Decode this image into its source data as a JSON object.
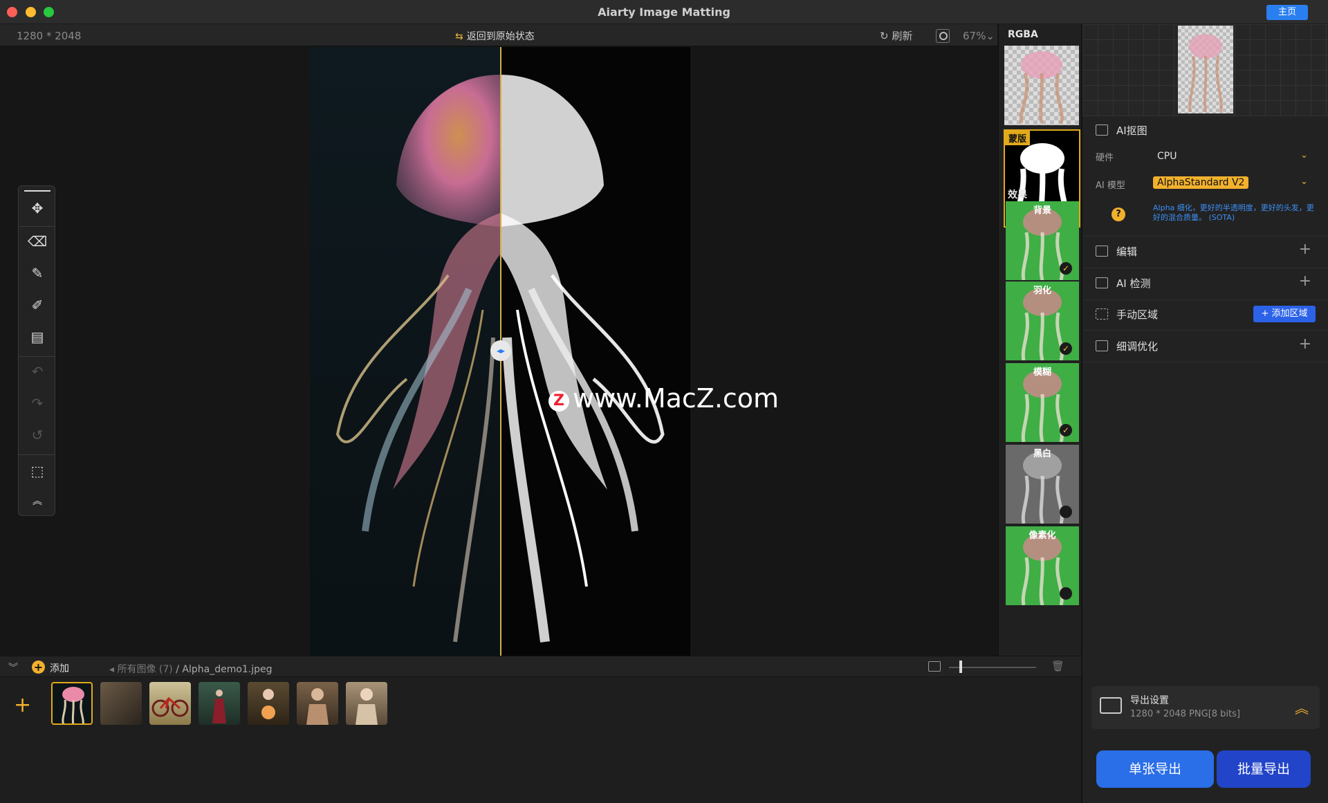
{
  "window": {
    "title": "Aiarty Image Matting",
    "home_button": "主页"
  },
  "canvas_bar": {
    "dimensions": "1280 * 2048",
    "revert": "返回到原始状态",
    "refresh": "刷新",
    "zoom": "67%"
  },
  "watermark": {
    "text": "www.MacZ.com",
    "logo": "Z"
  },
  "side": {
    "rgba_label": "RGBA",
    "mask_label": "蒙版",
    "effects_label": "效果",
    "effects": [
      {
        "label": "背景",
        "checked": true
      },
      {
        "label": "羽化",
        "checked": true
      },
      {
        "label": "模糊",
        "checked": true
      },
      {
        "label": "黑白",
        "checked": false
      },
      {
        "label": "像素化",
        "checked": false
      }
    ]
  },
  "panel": {
    "ai_matting": "AI抠图",
    "hardware_label": "硬件",
    "hardware_value": "CPU",
    "model_label": "AI 模型",
    "model_value": "AlphaStandard  V2",
    "model_desc": "Alpha 细化，更好的半透明度，更好的头发，更好的混合质量。 (SOTA)",
    "help": "?",
    "edit": "编辑",
    "ai_detect": "AI 检测",
    "manual_region": "手动区域",
    "add_region": "添加区域",
    "refine": "细调优化",
    "export_title": "导出设置",
    "export_sub": "1280 * 2048 PNG[8 bits]",
    "export_single": "单张导出",
    "export_batch": "批量导出"
  },
  "bottom": {
    "add": "添加",
    "all_images": "所有图像 (7)",
    "file": "/ Alpha_demo1.jpeg"
  },
  "thumbnails": [
    {
      "name": "jellyfish",
      "active": true
    },
    {
      "name": "rocks",
      "active": false
    },
    {
      "name": "bicycle",
      "active": false
    },
    {
      "name": "forest-woman",
      "active": false
    },
    {
      "name": "flower-woman",
      "active": false
    },
    {
      "name": "portrait-woman",
      "active": false
    },
    {
      "name": "lace-woman",
      "active": false
    }
  ],
  "colors": {
    "accent": "#2a7ff0",
    "gold": "#e2a91b",
    "green": "#3fae45"
  }
}
